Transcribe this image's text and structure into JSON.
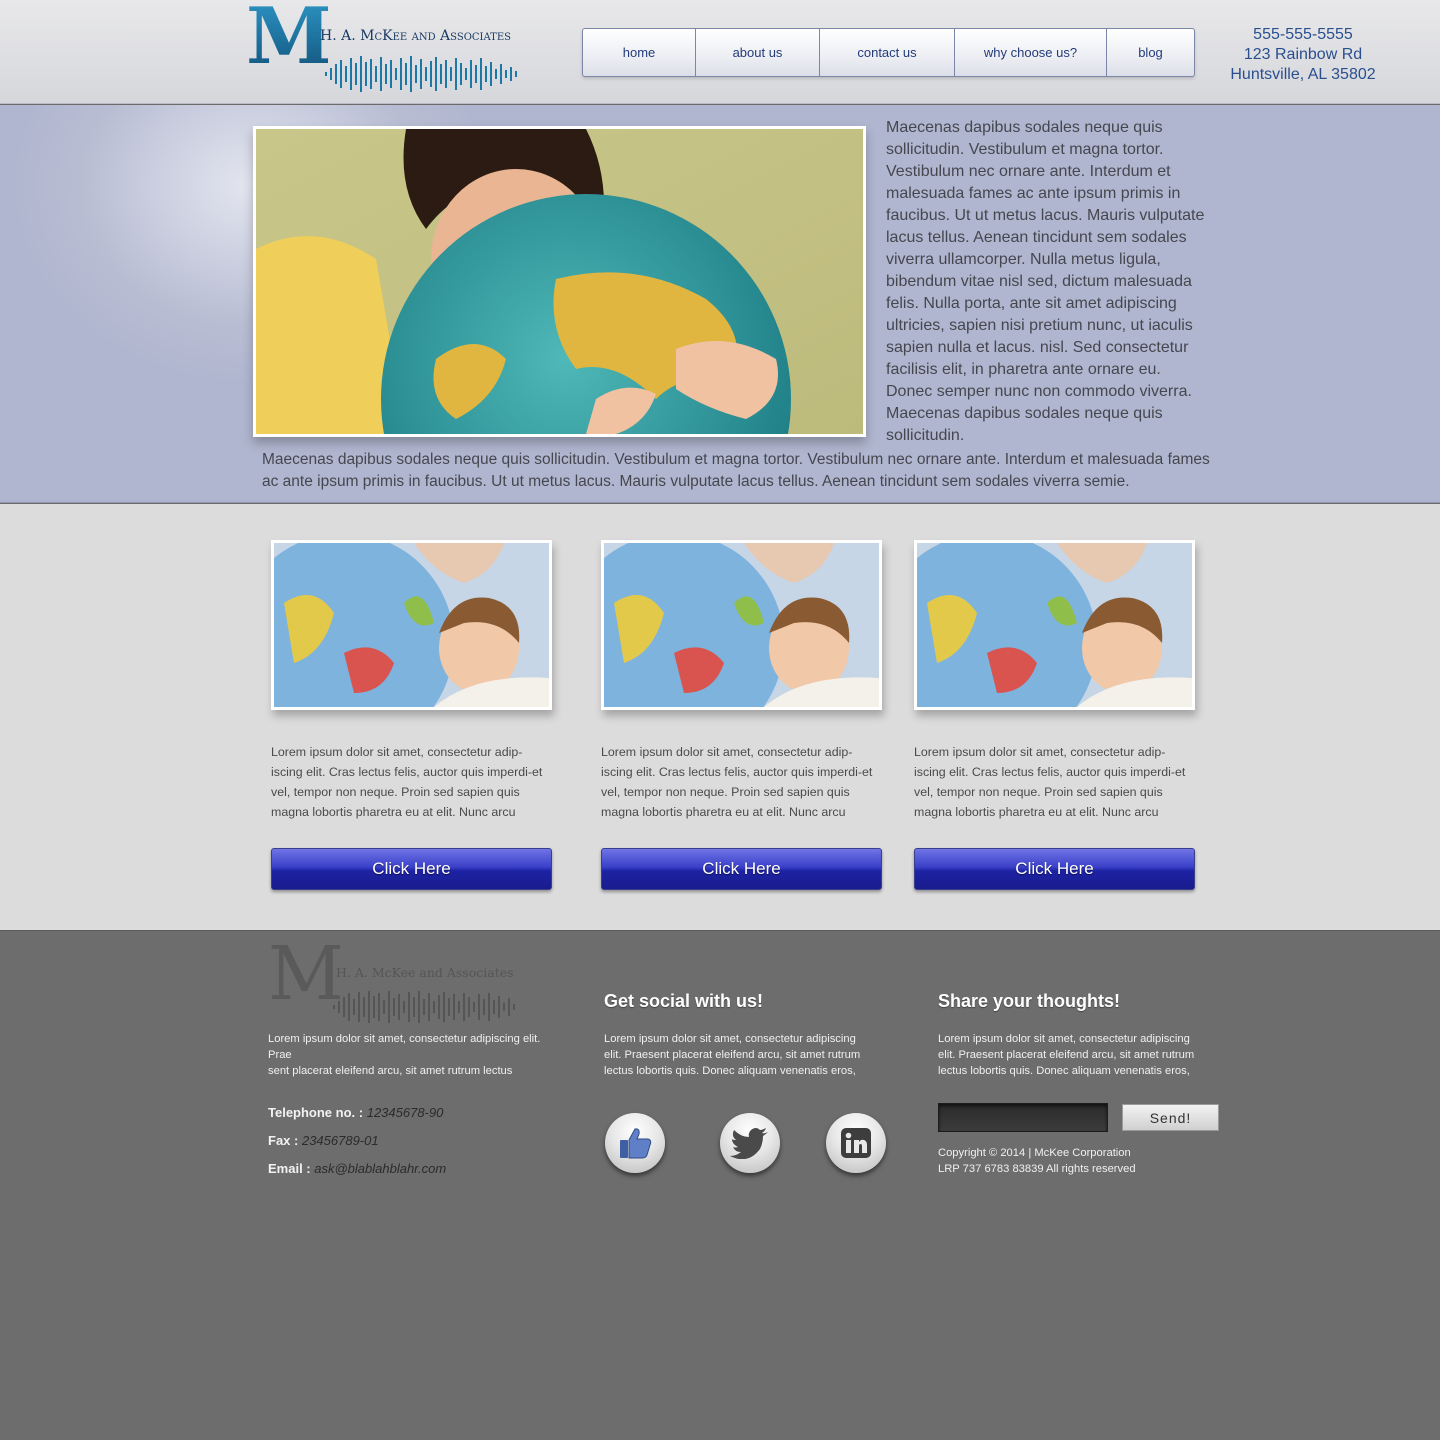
{
  "brand": {
    "monogram": "M",
    "name": "H. A. McKee and Associates"
  },
  "nav": [
    {
      "label": "home"
    },
    {
      "label": "about us"
    },
    {
      "label": "contact us"
    },
    {
      "label": "why choose us?"
    },
    {
      "label": "blog"
    }
  ],
  "contact": {
    "phone": "555-555-5555",
    "street": "123 Rainbow Rd",
    "city": "Huntsville, AL 35802"
  },
  "hero": {
    "side_text": "Maecenas dapibus sodales neque quis sollicitudin. Vestibulum et magna tortor. Vestibulum nec ornare ante. Interdum et malesuada fames ac ante ipsum primis in faucibus. Ut ut metus lacus. Mauris vulputate lacus tellus. Aenean tincidunt sem sodales viverra ullamcorper. Nulla metus ligula, bibendum vitae nisl sed, dictum malesuada felis. Nulla porta, ante sit amet adipiscing ultricies, sapien nisi pretium nunc, ut iaculis sapien nulla et lacus.  nisl. Sed consectetur facilisis elit, in pharetra ante ornare eu. Donec semper nunc non commodo viverra. Maecenas dapibus sodales neque quis sollicitudin.",
    "wide_text": "Maecenas dapibus sodales neque quis sollicitudin.  Vestibulum et magna tortor. Vestibulum nec ornare ante. Interdum et malesuada fames ac ante ipsum primis in faucibus. Ut ut metus lacus. Mauris vulputate lacus tellus. Aenean tincidunt sem sodales viverra semie."
  },
  "cards": [
    {
      "text": "Lorem ipsum dolor sit amet, consectetur adip-iscing elit. Cras lectus felis, auctor quis imperdi-et vel, tempor non neque. Proin sed sapien quis magna lobortis pharetra eu at elit. Nunc arcu",
      "button": "Click Here"
    },
    {
      "text": "Lorem ipsum dolor sit amet, consectetur adip-iscing elit. Cras lectus felis, auctor quis imperdi-et vel, tempor non neque. Proin sed sapien quis magna lobortis pharetra eu at elit. Nunc arcu",
      "button": "Click Here"
    },
    {
      "text": "Lorem ipsum dolor sit amet, consectetur adip-iscing elit. Cras lectus felis, auctor quis imperdi-et vel, tempor non neque. Proin sed sapien quis magna lobortis pharetra eu at elit. Nunc arcu",
      "button": "Click Here"
    }
  ],
  "footer": {
    "about_text_1": "Lorem ipsum dolor sit amet, consectetur adipiscing elit. Prae",
    "about_text_2": "sent placerat eleifend arcu, sit amet rutrum lectus",
    "telephone_label": "Telephone no. :",
    "telephone_value": "12345678-90",
    "fax_label": "Fax :",
    "fax_value": "23456789-01",
    "email_label": "Email :",
    "email_value": "ask@blablahblahr.com",
    "social_heading": "Get social with us!",
    "social_text": "Lorem ipsum dolor sit amet, consectetur adipiscing elit. Praesent placerat eleifend arcu, sit amet rutrum lectus lobortis quis. Donec aliquam venenatis eros,",
    "social_icons": [
      "like-icon",
      "twitter-icon",
      "linkedin-icon"
    ],
    "thoughts_heading": "Share your thoughts!",
    "thoughts_text": "Lorem ipsum dolor sit amet, consectetur adipiscing elit. Praesent placerat eleifend arcu, sit amet rutrum lectus lobortis quis. Donec aliquam venenatis eros,",
    "send_label": "Send!",
    "copyright_1": "Copyright © 2014 | McKee Corporation",
    "copyright_2": "LRP 737 6783 83839  All rights reserved"
  },
  "colors": {
    "brand_blue": "#1d78a6",
    "nav_text": "#233b7a",
    "button_blue": "#2a30b8",
    "footer_bg": "#6d6d6d"
  }
}
